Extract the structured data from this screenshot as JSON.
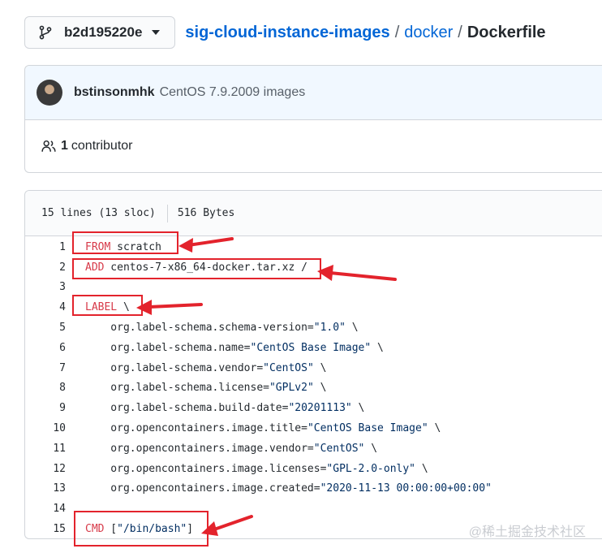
{
  "header": {
    "branch": "b2d195220e",
    "repo": "sig-cloud-instance-images",
    "folder": "docker",
    "file": "Dockerfile",
    "separator": "/"
  },
  "commit": {
    "author": "bstinsonmhk",
    "message": "CentOS 7.9.2009 images"
  },
  "contributors": {
    "count": "1",
    "label": "contributor"
  },
  "file_info": {
    "lines": "15 lines (13 sloc)",
    "size": "516 Bytes"
  },
  "code_lines": [
    {
      "num": "1",
      "kw": "FROM",
      "rest": " scratch"
    },
    {
      "num": "2",
      "kw": "ADD",
      "rest": " centos-7-x86_64-docker.tar.xz /"
    },
    {
      "num": "3",
      "kw": "",
      "rest": ""
    },
    {
      "num": "4",
      "kw": "LABEL",
      "rest": " \\"
    },
    {
      "num": "5",
      "kw": "",
      "rest": "    org.label-schema.schema-version=",
      "str": "\"1.0\"",
      "tail": " \\"
    },
    {
      "num": "6",
      "kw": "",
      "rest": "    org.label-schema.name=",
      "str": "\"CentOS Base Image\"",
      "tail": " \\"
    },
    {
      "num": "7",
      "kw": "",
      "rest": "    org.label-schema.vendor=",
      "str": "\"CentOS\"",
      "tail": " \\"
    },
    {
      "num": "8",
      "kw": "",
      "rest": "    org.label-schema.license=",
      "str": "\"GPLv2\"",
      "tail": " \\"
    },
    {
      "num": "9",
      "kw": "",
      "rest": "    org.label-schema.build-date=",
      "str": "\"20201113\"",
      "tail": " \\"
    },
    {
      "num": "10",
      "kw": "",
      "rest": "    org.opencontainers.image.title=",
      "str": "\"CentOS Base Image\"",
      "tail": " \\"
    },
    {
      "num": "11",
      "kw": "",
      "rest": "    org.opencontainers.image.vendor=",
      "str": "\"CentOS\"",
      "tail": " \\"
    },
    {
      "num": "12",
      "kw": "",
      "rest": "    org.opencontainers.image.licenses=",
      "str": "\"GPL-2.0-only\"",
      "tail": " \\"
    },
    {
      "num": "13",
      "kw": "",
      "rest": "    org.opencontainers.image.created=",
      "str": "\"2020-11-13 00:00:00+00:00\"",
      "tail": ""
    },
    {
      "num": "14",
      "kw": "",
      "rest": ""
    },
    {
      "num": "15",
      "kw": "CMD",
      "rest": " [",
      "str": "\"/bin/bash\"",
      "tail": "]"
    }
  ],
  "watermark": "@稀土掘金技术社区",
  "colors": {
    "link": "#0366d6",
    "keyword": "#d73a49",
    "string": "#032f62",
    "annotation": "#e3232c"
  }
}
